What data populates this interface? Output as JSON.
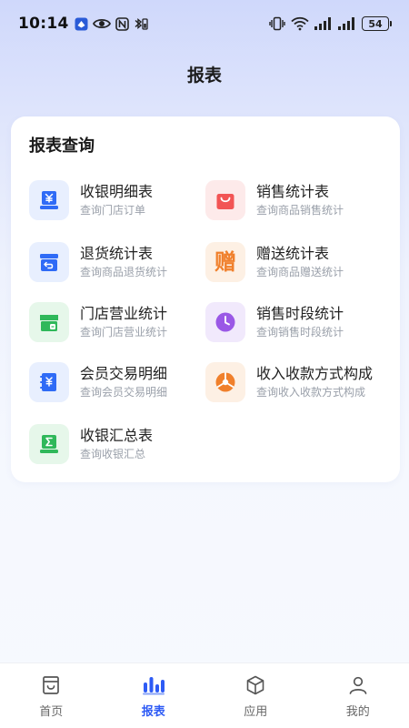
{
  "status_bar": {
    "time": "10:14",
    "battery": "54"
  },
  "header": {
    "title": "报表"
  },
  "card": {
    "title": "报表查询",
    "items": [
      {
        "name": "收银明细表",
        "desc": "查询门店订单",
        "icon": "cash-register-icon",
        "color": "#2f6bf6",
        "bg": "#e8effe"
      },
      {
        "name": "销售统计表",
        "desc": "查询商品销售统计",
        "icon": "shopping-bag-icon",
        "color": "#f25555",
        "bg": "#fdeaea"
      },
      {
        "name": "退货统计表",
        "desc": "查询商品退货统计",
        "icon": "return-box-icon",
        "color": "#2f6bf6",
        "bg": "#e8effe"
      },
      {
        "name": "赠送统计表",
        "desc": "查询商品赠送统计",
        "icon": "gift-char-icon",
        "color": "#f0802c",
        "bg": "#fdf0e4",
        "glyph": "赠"
      },
      {
        "name": "门店营业统计",
        "desc": "查询门店营业统计",
        "icon": "store-icon",
        "color": "#2fb85a",
        "bg": "#e6f7ea"
      },
      {
        "name": "销售时段统计",
        "desc": "查询销售时段统计",
        "icon": "clock-icon",
        "color": "#9a58e6",
        "bg": "#f1e9fc"
      },
      {
        "name": "会员交易明细",
        "desc": "查询会员交易明细",
        "icon": "member-card-icon",
        "color": "#2f6bf6",
        "bg": "#e8effe"
      },
      {
        "name": "收入收款方式构成",
        "desc": "查询收入收款方式构成",
        "icon": "pie-chart-icon",
        "color": "#f0802c",
        "bg": "#fdf0e4"
      },
      {
        "name": "收银汇总表",
        "desc": "查询收银汇总",
        "icon": "summary-icon",
        "color": "#2fb85a",
        "bg": "#e6f7ea"
      }
    ]
  },
  "bottom_nav": {
    "active_color": "#2e5bf5",
    "items": [
      {
        "label": "首页",
        "icon": "home-icon"
      },
      {
        "label": "报表",
        "icon": "report-chart-icon"
      },
      {
        "label": "应用",
        "icon": "apps-cube-icon"
      },
      {
        "label": "我的",
        "icon": "user-icon"
      }
    ]
  }
}
